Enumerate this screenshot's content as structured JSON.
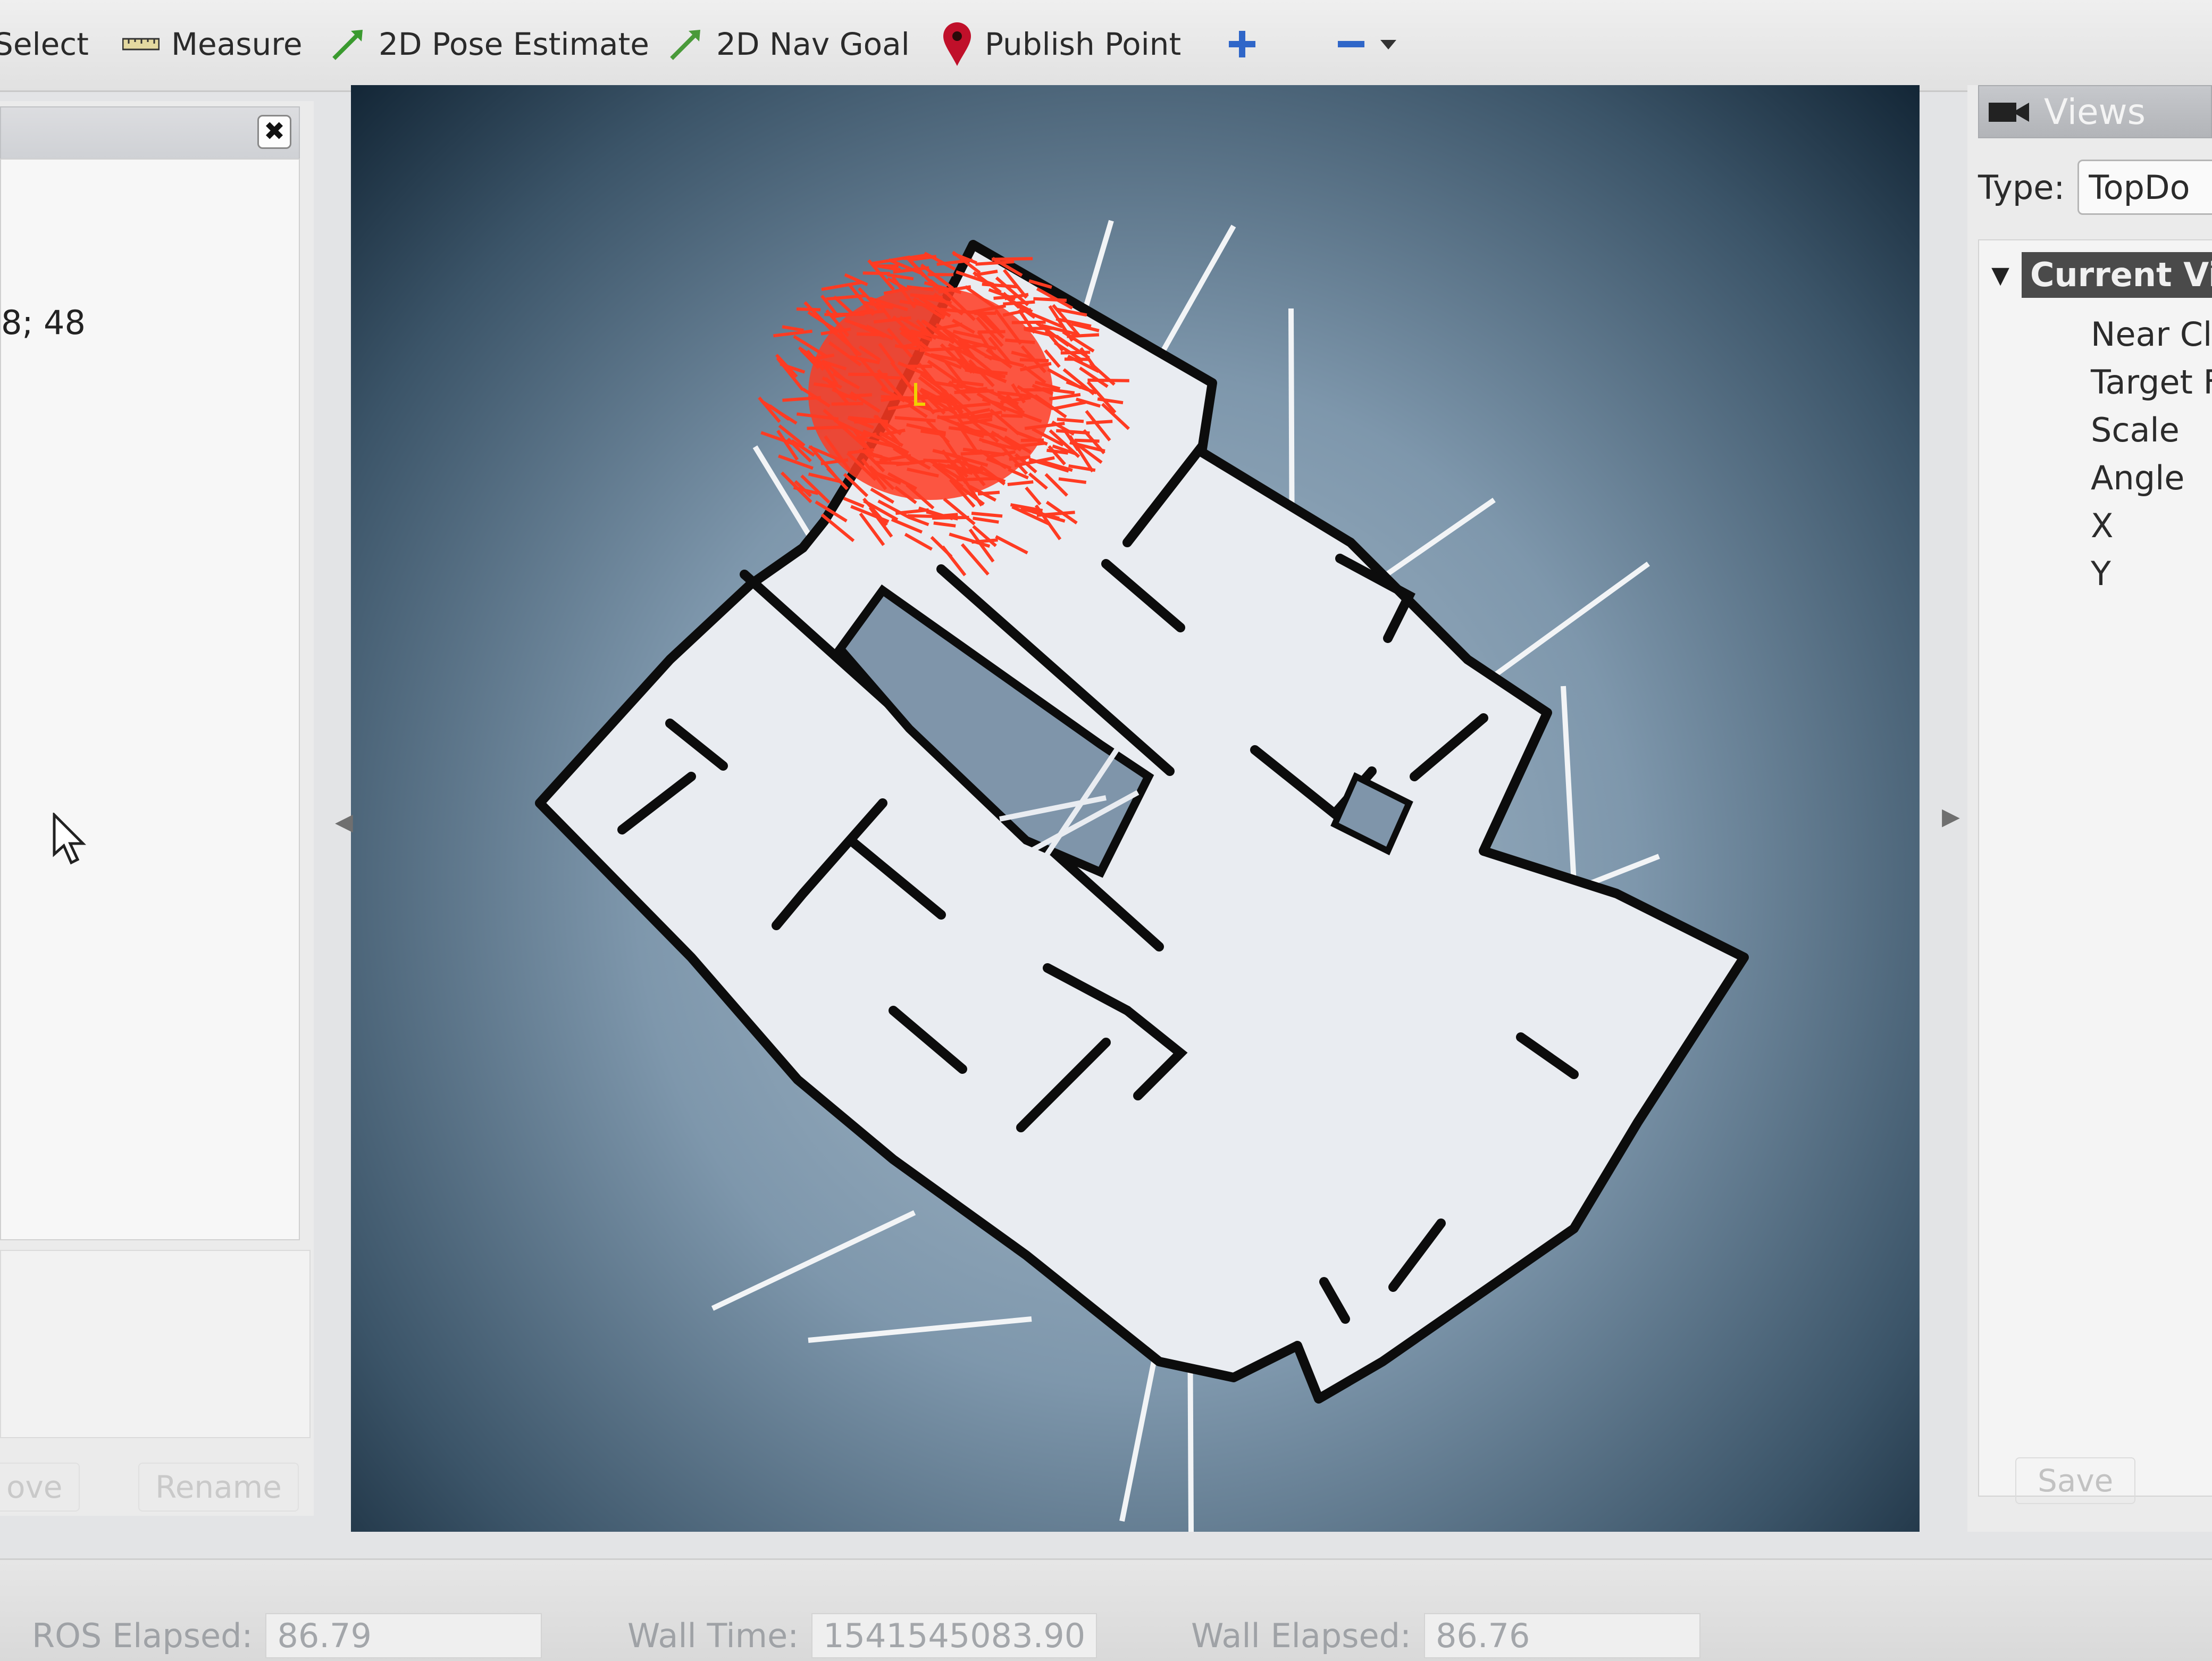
{
  "toolbar": {
    "select_label": "Select",
    "measure_label": "Measure",
    "pose_estimate_label": "2D Pose Estimate",
    "nav_goal_label": "2D Nav Goal",
    "publish_point_label": "Publish Point",
    "icons": [
      "select-icon",
      "ruler-icon",
      "pose-arrow-icon",
      "nav-arrow-icon",
      "map-pin-icon",
      "plus-icon",
      "minus-icon",
      "dropdown-arrow-icon"
    ]
  },
  "left_panel": {
    "close_glyph": "✖",
    "value_text": "8; 48",
    "remove_label": "ove",
    "rename_label": "Rename"
  },
  "views_panel": {
    "title": "Views",
    "type_label": "Type:",
    "type_value": "TopDo",
    "current_view_label": "Current Vi",
    "properties": [
      "Near Cli",
      "Target F",
      "Scale",
      "Angle",
      "X",
      "Y"
    ],
    "save_label": "Save"
  },
  "status_bar": {
    "ros_elapsed_label": "ROS Elapsed:",
    "ros_elapsed_value": "86.79",
    "wall_time_label": "Wall Time:",
    "wall_time_value": "1541545083.90",
    "wall_elapsed_label": "Wall Elapsed:",
    "wall_elapsed_value": "86.76"
  },
  "colors": {
    "particle_cloud": "#ff3b22",
    "map_free": "#e9ecf1",
    "map_wall": "#0c0c0c",
    "viewport_edge": "#132636"
  }
}
